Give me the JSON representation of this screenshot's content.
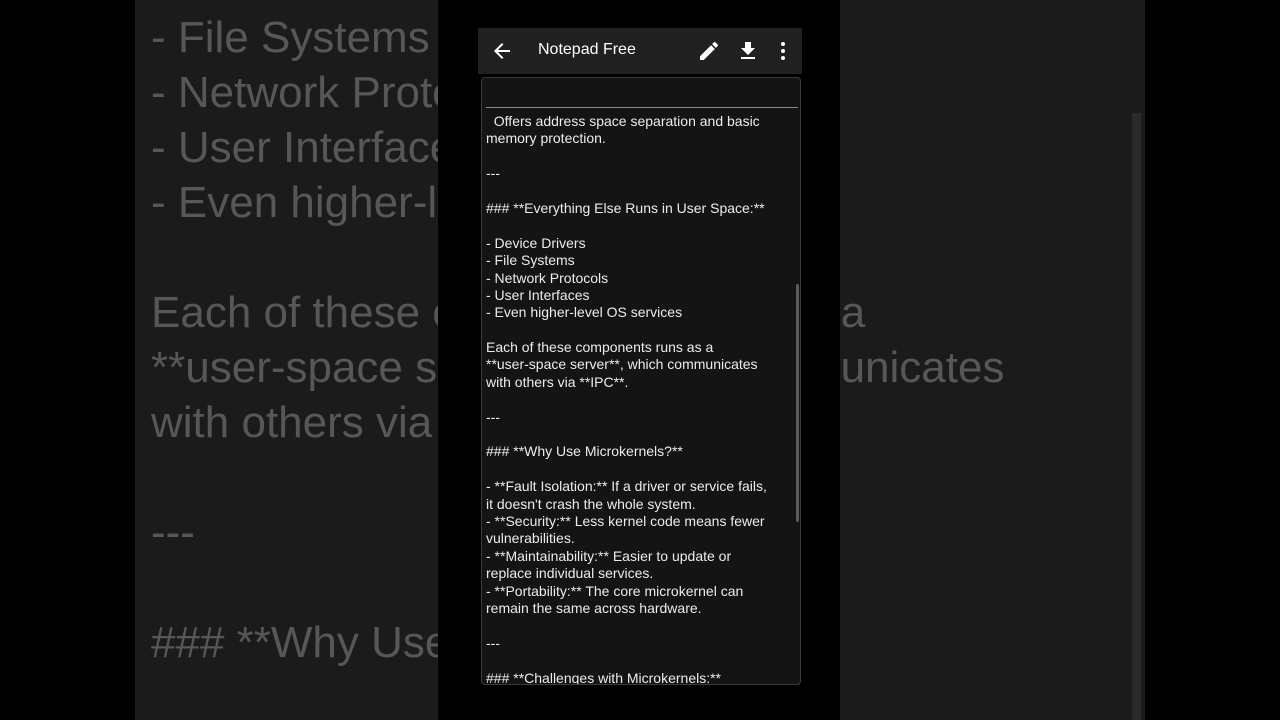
{
  "app": {
    "title": "Notepad Free",
    "actions": [
      "edit-icon",
      "download-icon",
      "more-vertical-icon"
    ],
    "back_icon": "arrow-back-icon"
  },
  "note": {
    "lines": [
      "  Offers address space separation and basic",
      "memory protection.",
      "",
      "---",
      "",
      "### **Everything Else Runs in User Space:**",
      "",
      "- Device Drivers",
      "- File Systems",
      "- Network Protocols",
      "- User Interfaces",
      "- Even higher-level OS services",
      "",
      "Each of these components runs as a",
      "**user-space server**, which communicates",
      "with others via **IPC**.",
      "",
      "---",
      "",
      "### **Why Use Microkernels?**",
      "",
      "- **Fault Isolation:** If a driver or service fails,",
      "it doesn't crash the whole system.",
      "- **Security:** Less kernel code means fewer",
      "vulnerabilities.",
      "- **Maintainability:** Easier to update or",
      "replace individual services.",
      "- **Portability:** The core microkernel can",
      "remain the same across hardware.",
      "",
      "---",
      "",
      "### **Challenges with Microkernels:**"
    ]
  },
  "background": {
    "lines": [
      "- File Systems",
      "- Network Protocols",
      "- User Interfaces",
      "- Even higher-level OS services",
      "",
      "Each of these components runs as a",
      "**user-space server**, which communicates",
      "with others via **IPC**.",
      "",
      "---",
      "",
      "### **Why Use Microkernels?**"
    ]
  },
  "colors": {
    "appbar": "#212121",
    "editor_bg": "#141414",
    "text": "#ececec",
    "background_text": "#575757"
  }
}
